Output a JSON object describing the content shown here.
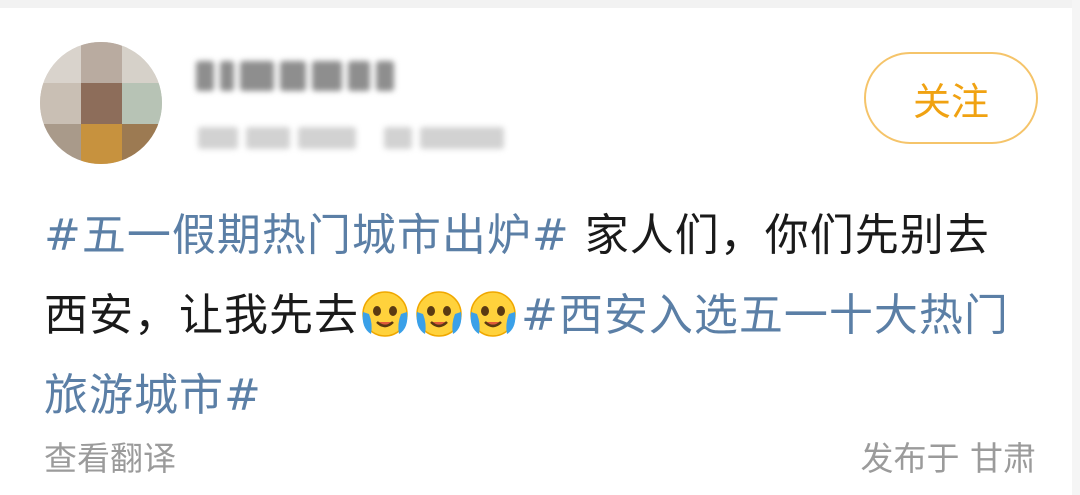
{
  "post": {
    "author_name": "",
    "timestamp": "",
    "follow_label": "关注",
    "text": {
      "hashtag1": "#五一假期热门城市出炉#",
      "body": " 家人们，你们先别去西安，让我先去",
      "emoji": [
        "crying-face",
        "crying-face",
        "crying-face"
      ],
      "hashtag2": "#西安入选五一十大热门旅游城市#"
    },
    "translate_label": "查看翻译",
    "location_label": "发布于 甘肃"
  },
  "colors": {
    "hashtag": "#5b7fa6",
    "follow_text": "#f0a212",
    "follow_border": "#f5c46a",
    "secondary_text": "#9b9b9b"
  }
}
